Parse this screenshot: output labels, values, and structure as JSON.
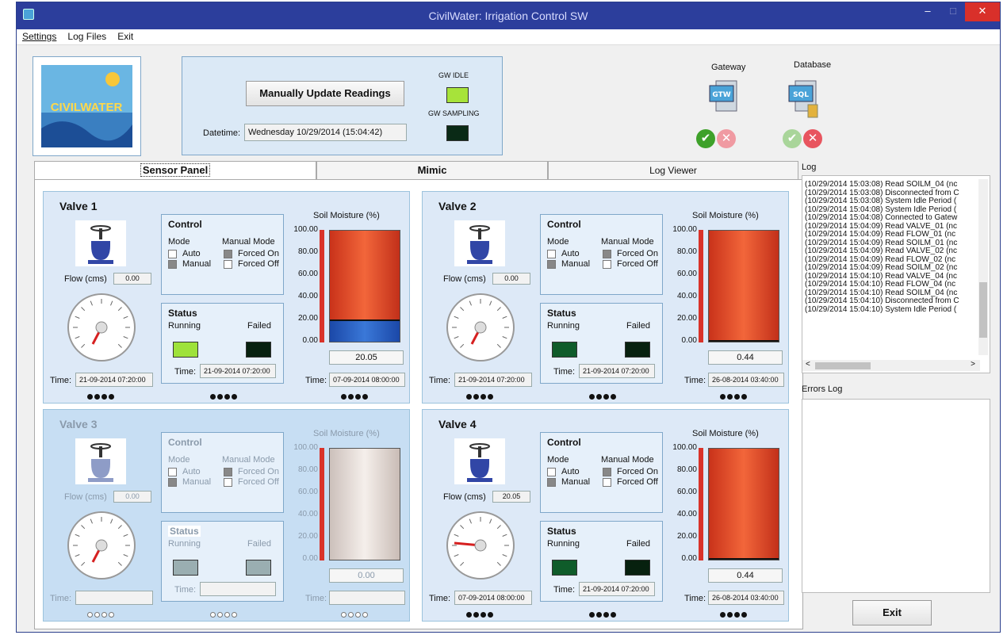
{
  "window": {
    "title": "CivilWater: Irrigation Control SW",
    "minimize": "–",
    "maximize": "□",
    "close": "✕"
  },
  "menu": [
    "Settings",
    "Log Files",
    "Exit"
  ],
  "logo": {
    "text": "CIVILWATER"
  },
  "top": {
    "update_button": "Manually Update Readings",
    "datetime_label": "Datetime:",
    "datetime_value": "Wednesday 10/29/2014 (15:04:42)",
    "gw_idle": "GW IDLE",
    "gw_sampling": "GW SAMPLING"
  },
  "gateway": {
    "label": "Gateway",
    "icon_text": "GTW"
  },
  "database": {
    "label": "Database",
    "icon_text": "SQL"
  },
  "tabs": [
    "Sensor Panel",
    "Mimic",
    "Log Viewer"
  ],
  "log": {
    "label": "Log",
    "entries": [
      "(10/29/2014 15:03:08) Read SOILM_04 (nc",
      "(10/29/2014 15:03:08) Disconnected from C",
      "(10/29/2014 15:03:08) System Idle Period (",
      "(10/29/2014 15:04:08) System Idle Period (",
      "(10/29/2014 15:04:08) Connected to Gatew",
      "(10/29/2014 15:04:09) Read VALVE_01 (nc",
      "(10/29/2014 15:04:09) Read FLOW_01 (nc",
      "(10/29/2014 15:04:09) Read SOILM_01 (nc",
      "(10/29/2014 15:04:09) Read VALVE_02 (nc",
      "(10/29/2014 15:04:09) Read FLOW_02 (nc",
      "(10/29/2014 15:04:09) Read SOILM_02 (nc",
      "(10/29/2014 15:04:10) Read VALVE_04 (nc",
      "(10/29/2014 15:04:10) Read FLOW_04 (nc",
      "(10/29/2014 15:04:10) Read SOILM_04 (nc",
      "(10/29/2014 15:04:10) Disconnected from C",
      "(10/29/2014 15:04:10) System Idle Period ("
    ]
  },
  "errors_log": {
    "label": "Errors Log"
  },
  "exit_button": "Exit",
  "labels": {
    "control": "Control",
    "mode": "Mode",
    "manual_mode": "Manual Mode",
    "auto": "Auto",
    "manual": "Manual",
    "forced_on": "Forced On",
    "forced_off": "Forced Off",
    "status": "Status",
    "running": "Running",
    "failed": "Failed",
    "time": "Time:",
    "flow": "Flow (cms)",
    "soil": "Soil Moisture (%)"
  },
  "valves": [
    {
      "title": "Valve 1",
      "flow": "0.00",
      "time": "21-09-2014 07:20:00",
      "status_time": "21-09-2014 07:20:00",
      "soil_time": "07-09-2014 08:00:00",
      "moisture": "20.05",
      "moisture_level": 20.05,
      "yticks": [
        "100.00",
        "80.00",
        "60.00",
        "40.00",
        "20.00",
        "0.00"
      ],
      "mode": "manual",
      "manual_mode": "forced_on",
      "running": "on",
      "failed": "off",
      "disabled": false
    },
    {
      "title": "Valve 2",
      "flow": "0.00",
      "time": "21-09-2014 07:20:00",
      "status_time": "21-09-2014 07:20:00",
      "soil_time": "26-08-2014 03:40:00",
      "moisture": "0.44",
      "moisture_level": 0.44,
      "yticks": [
        "100.00",
        "80.00",
        "60.00",
        "40.00",
        "20.00",
        "0.00"
      ],
      "mode": "manual",
      "manual_mode": "forced_on",
      "running": "off",
      "failed": "off",
      "disabled": false
    },
    {
      "title": "Valve 3",
      "flow": "0.00",
      "time": "",
      "status_time": "",
      "soil_time": "",
      "moisture": "0.00",
      "moisture_level": 0,
      "yticks": [
        "100.00",
        "80.00",
        "60.00",
        "40.00",
        "20.00",
        "0.00"
      ],
      "mode": "manual",
      "manual_mode": "forced_on",
      "running": "dis",
      "failed": "dis",
      "disabled": true
    },
    {
      "title": "Valve 4",
      "flow": "20.05",
      "time": "07-09-2014 08:00:00",
      "status_time": "21-09-2014 07:20:00",
      "soil_time": "26-08-2014 03:40:00",
      "moisture": "0.44",
      "moisture_level": 0.44,
      "yticks": [
        "100.00",
        "80.00",
        "60.00",
        "40.00",
        "20.00",
        "0.00"
      ],
      "mode": "manual",
      "manual_mode": "forced_on",
      "running": "off",
      "failed": "off",
      "disabled": false
    }
  ]
}
